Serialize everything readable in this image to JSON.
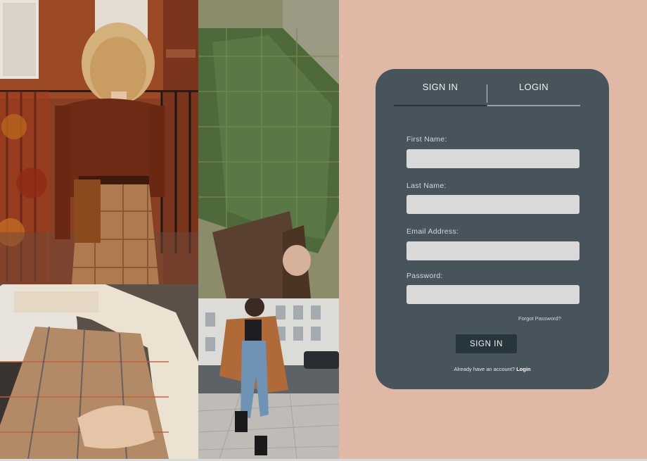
{
  "photos": [
    {
      "alt": "woman in brown cardigan and plaid trousers"
    },
    {
      "alt": "green tweed blazer detail"
    },
    {
      "alt": "plaid trousers and cream sweater"
    },
    {
      "alt": "woman in camel coat and jeans on street"
    }
  ],
  "form": {
    "tabs": [
      {
        "label": "SIGN IN",
        "active": true
      },
      {
        "label": "LOGIN",
        "active": false
      }
    ],
    "fields": [
      {
        "label": "First Name:",
        "value": ""
      },
      {
        "label": "Last Name:",
        "value": ""
      },
      {
        "label": "Email Address:",
        "value": ""
      },
      {
        "label": "Password:",
        "value": ""
      }
    ],
    "forgot_label": "Forgot Password?",
    "submit_label": "SIGN IN",
    "already_text": "Already have an account?",
    "already_link": "Login"
  },
  "colors": {
    "panel_background": "#dfb9a5",
    "card_background": "#48545c",
    "input_background": "#d9d9d9",
    "button_background": "#27353c"
  }
}
